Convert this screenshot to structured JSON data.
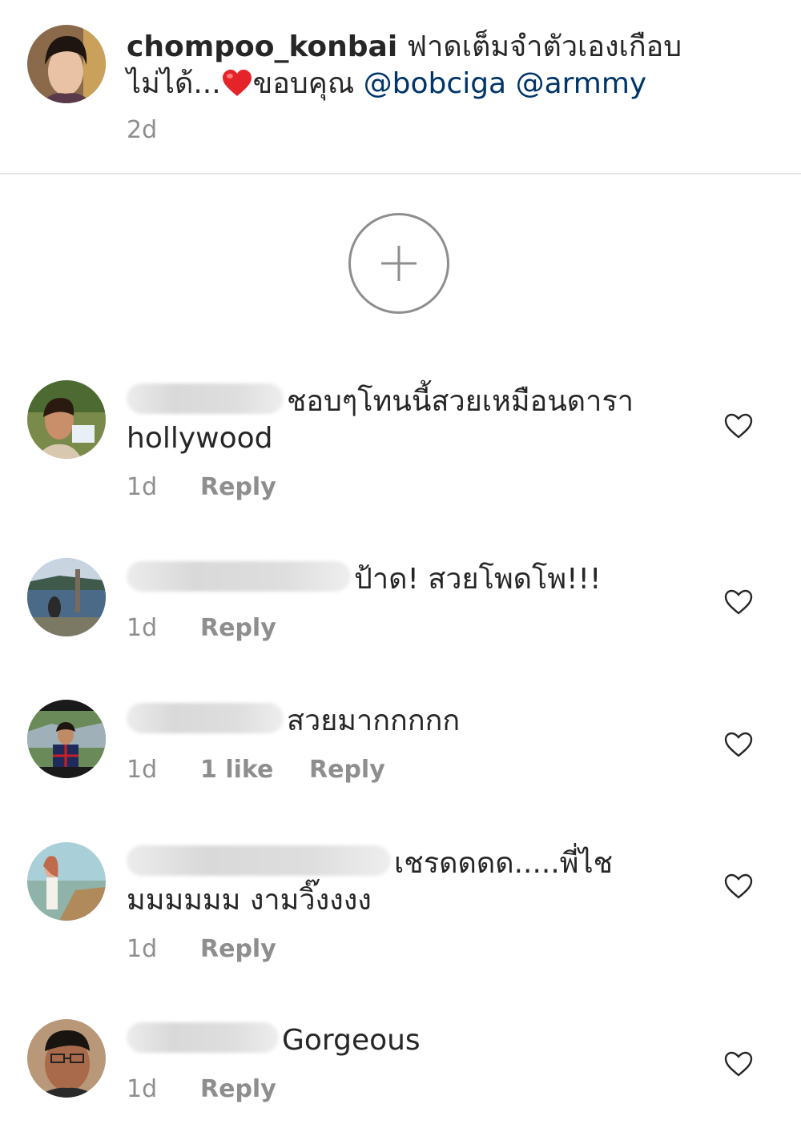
{
  "caption": {
    "username": "chompoo_konbai",
    "text_before": "ฟาดเต็มจำตัวเองเกือบไม่ได้...",
    "text_after": "ขอบคุณ",
    "mentions": [
      "@bobciga",
      "@armmy"
    ],
    "emoji": "red-heart",
    "time": "2d"
  },
  "load_more": {
    "icon": "plus-circle-icon"
  },
  "comments": [
    {
      "text": "ชอบๆโทนนี้สวยเหมือนดารา hollywood",
      "time": "1d",
      "likes": "",
      "reply": "Reply"
    },
    {
      "text": "ป้าด! สวยโพดโพ!!!",
      "time": "1d",
      "likes": "",
      "reply": "Reply"
    },
    {
      "text": "สวยมากกกกก",
      "time": "1d",
      "likes": "1 like",
      "reply": "Reply"
    },
    {
      "text": "เชรดดดด.....พี่ไชมมมมมม งามวิ๊งงงง",
      "time": "1d",
      "likes": "",
      "reply": "Reply"
    },
    {
      "text": "Gorgeous",
      "time": "1d",
      "likes": "",
      "reply": "Reply"
    }
  ],
  "colors": {
    "text": "#262626",
    "muted": "#8e8e8e",
    "mention": "#003569",
    "divider": "#e6e6e6"
  }
}
